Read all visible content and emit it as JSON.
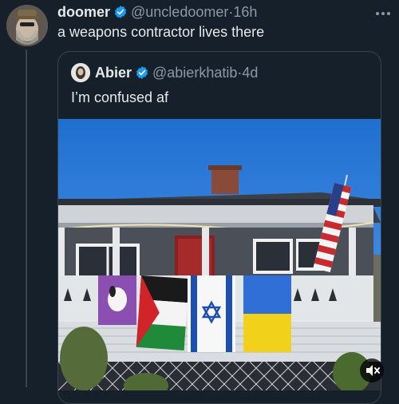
{
  "tweet": {
    "author_name": "doomer",
    "author_handle": "@uncledoomer",
    "separator": "·",
    "time": "16h",
    "text": "a weapons contractor lives there",
    "more_icon": "more-icon",
    "verified_color": "#1d9bf0"
  },
  "quoted": {
    "author_name": "Abier",
    "author_handle": "@abierkhatib",
    "separator": "·",
    "time": "4d",
    "text": "I’m confused af"
  },
  "media": {
    "mute_icon": "speaker-muted-icon"
  }
}
